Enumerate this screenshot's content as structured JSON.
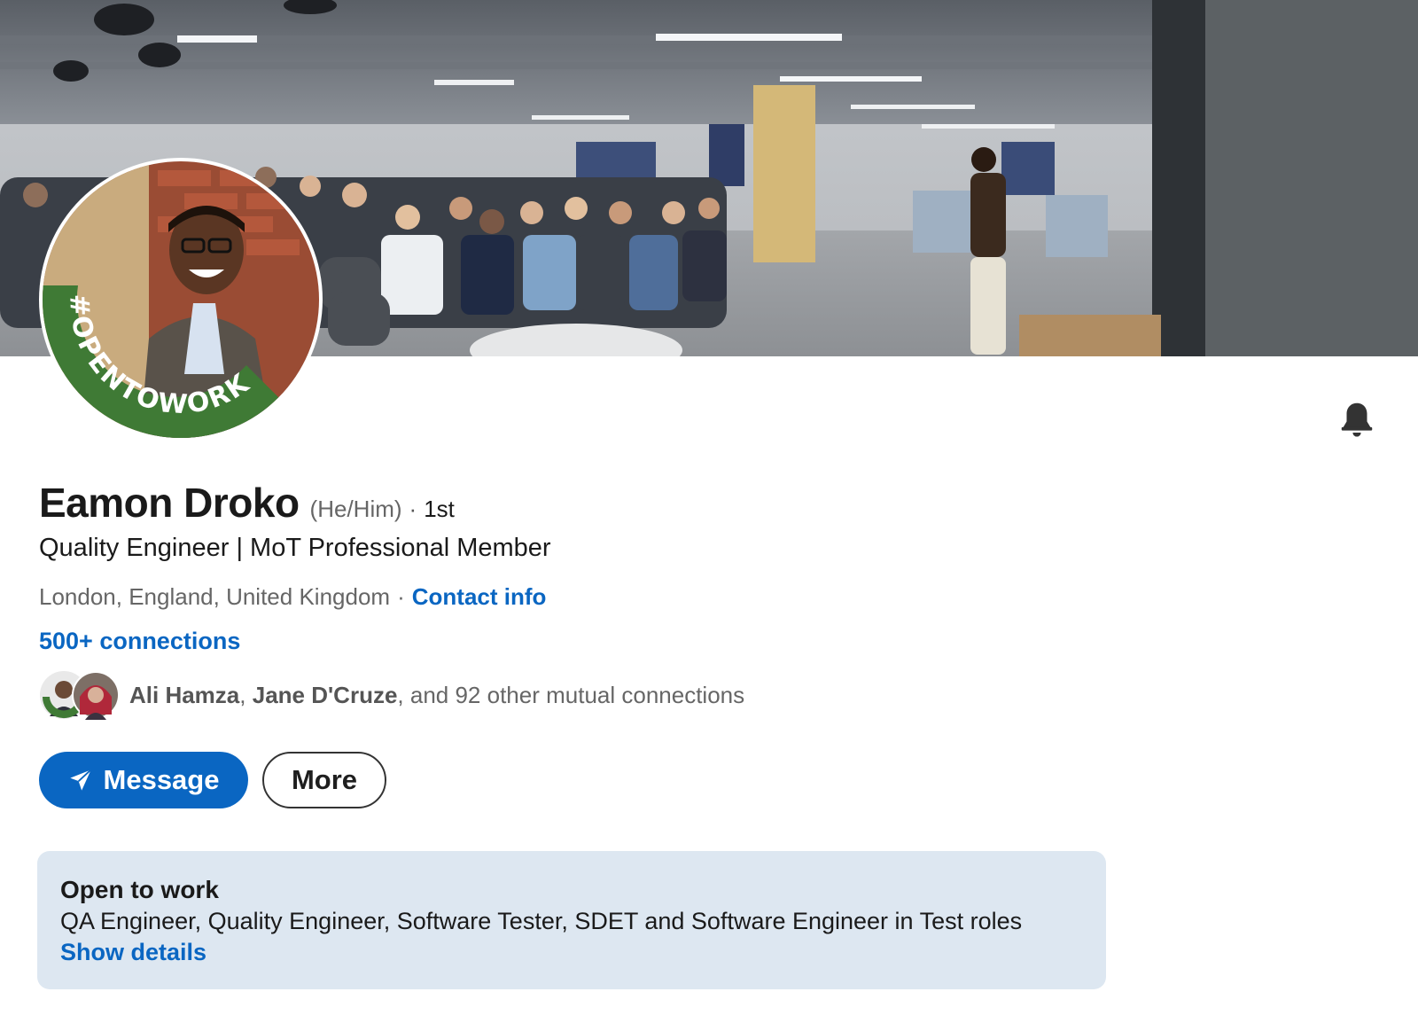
{
  "profile": {
    "name": "Eamon Droko",
    "pronouns": "(He/Him)",
    "degree_separator": "·",
    "degree": "1st",
    "headline": "Quality Engineer | MoT Professional Member",
    "location": "London, England, United Kingdom",
    "location_separator": "·",
    "contact_info_label": "Contact info",
    "connections_label": "500+ connections",
    "open_to_work_frame_text": "#OPENTOWORK"
  },
  "mutual": {
    "name1": "Ali Hamza",
    "comma": ",",
    "name2": "Jane D'Cruze",
    "rest": ", and 92 other mutual connections"
  },
  "actions": {
    "message_label": "Message",
    "more_label": "More"
  },
  "open_to_work": {
    "title": "Open to work",
    "roles": "QA Engineer, Quality Engineer, Software Tester, SDET and Software Engineer in Test roles",
    "show_details_label": "Show details"
  },
  "icons": {
    "notification": "bell-icon",
    "message": "send-icon"
  },
  "colors": {
    "link_blue": "#0a66c2",
    "open_to_work_green": "#3f7a35",
    "card_background": "#dde7f1"
  }
}
